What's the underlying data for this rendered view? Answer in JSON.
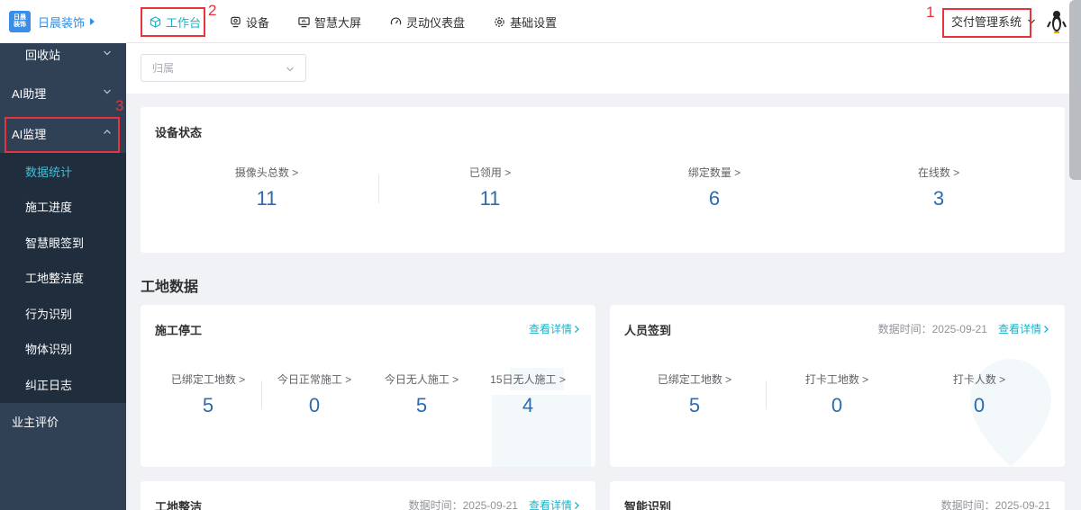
{
  "brand": {
    "logo_line1": "日晨",
    "logo_line2": "装饰",
    "name": "日晨装饰"
  },
  "nav": [
    {
      "label": "工作台",
      "icon": "cube-icon",
      "active": true
    },
    {
      "label": "设备",
      "icon": "camera-icon"
    },
    {
      "label": "智慧大屏",
      "icon": "monitor-icon"
    },
    {
      "label": "灵动仪表盘",
      "icon": "dashboard-icon"
    },
    {
      "label": "基础设置",
      "icon": "gear-icon"
    }
  ],
  "annotations": {
    "n1": "1",
    "n2": "2",
    "n3": "3"
  },
  "system_select": "交付管理系统",
  "sidebar": {
    "top_items": [
      {
        "label": "回收站"
      },
      {
        "label": "AI助理"
      },
      {
        "label": "AI监理"
      }
    ],
    "sub_items": [
      {
        "label": "数据统计",
        "active": true
      },
      {
        "label": "施工进度"
      },
      {
        "label": "智慧眼签到"
      },
      {
        "label": "工地整洁度"
      },
      {
        "label": "行为识别"
      },
      {
        "label": "物体识别"
      },
      {
        "label": "纠正日志"
      }
    ],
    "bottom_item": "业主评价"
  },
  "filter": {
    "placeholder": "归属"
  },
  "device_status": {
    "title": "设备状态",
    "stats": [
      {
        "label": "摄像头总数 >",
        "value": "11"
      },
      {
        "label": "已领用 >",
        "value": "11"
      },
      {
        "label": "绑定数量 >",
        "value": "6"
      },
      {
        "label": "在线数 >",
        "value": "3"
      }
    ]
  },
  "site_data_title": "工地数据",
  "construction_stop": {
    "title": "施工停工",
    "detail": "查看详情",
    "stats": [
      {
        "label": "已绑定工地数 >",
        "value": "5"
      },
      {
        "label": "今日正常施工 >",
        "value": "0"
      },
      {
        "label": "今日无人施工 >",
        "value": "5"
      },
      {
        "label": "15日无人施工 >",
        "value": "4"
      }
    ]
  },
  "staff_signin": {
    "title": "人员签到",
    "date_text": "数据时间：2025-09-21",
    "detail": "查看详情",
    "stats": [
      {
        "label": "已绑定工地数 >",
        "value": "5"
      },
      {
        "label": "打卡工地数 >",
        "value": "0"
      },
      {
        "label": "打卡人数 >",
        "value": "0"
      }
    ]
  },
  "site_clean": {
    "title": "工地整洁",
    "date_text": "数据时间：2025-09-21",
    "detail": "查看详情"
  },
  "smart_recog": {
    "title": "智能识别",
    "date_text": "数据时间：2025-09-21"
  },
  "colors": {
    "accent": "#1ab3c9",
    "value": "#2b6cb0",
    "sidebar": "#304156",
    "highlight": "#e5343c"
  }
}
